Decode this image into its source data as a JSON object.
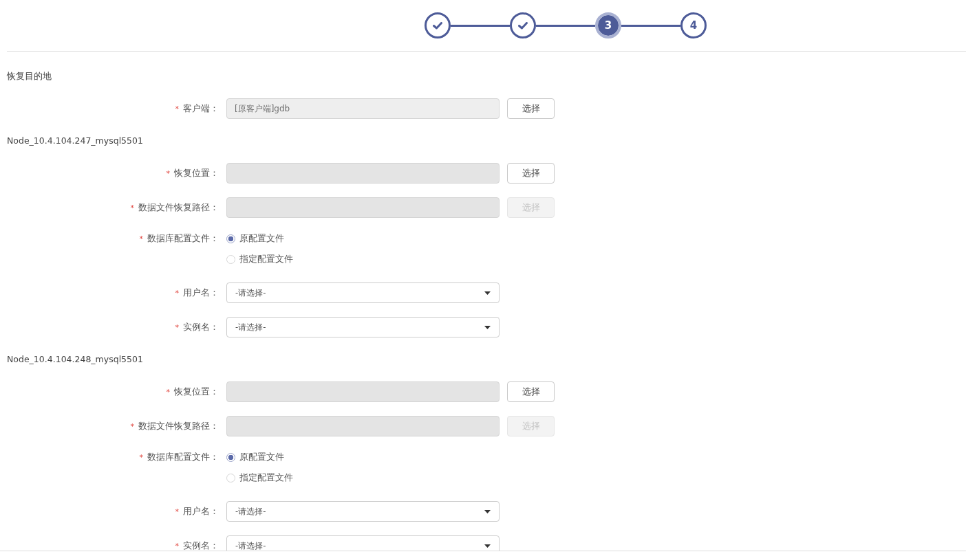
{
  "steps": [
    {
      "completed": true,
      "selected": false
    },
    {
      "completed": true,
      "selected": false
    },
    {
      "completed": false,
      "selected": true,
      "label": "3"
    },
    {
      "completed": false,
      "selected": false,
      "label": "4"
    }
  ],
  "sections": [
    {
      "title": "恢复目的地",
      "fields": [
        {
          "kind": "input",
          "mark": "*",
          "label": "客户端：",
          "value": "[原客户端]gdb",
          "button": {
            "label": "选择",
            "disabled": false
          }
        }
      ]
    },
    {
      "title": "Node_10.4.104.247_mysql5501",
      "fields": [
        {
          "kind": "input",
          "mark": "*",
          "label": "恢复位置：",
          "button": {
            "label": "选择",
            "disabled": false
          }
        },
        {
          "kind": "input",
          "mark": "*",
          "label": "数据文件恢复路径：",
          "button": {
            "label": "选择",
            "disabled": true
          }
        },
        {
          "kind": "radio",
          "mark": "*",
          "label": "数据库配置文件：",
          "options": [
            {
              "label": "原配置文件",
              "selected": true
            },
            {
              "label": "指定配置文件",
              "selected": false
            }
          ]
        },
        {
          "kind": "select",
          "mark": "*",
          "label": "用户名：",
          "value": "-请选择-"
        },
        {
          "kind": "select",
          "mark": "*",
          "label": "实例名：",
          "value": "-请选择-"
        }
      ]
    },
    {
      "title": "Node_10.4.104.248_mysql5501",
      "fields": [
        {
          "kind": "input",
          "mark": "*",
          "label": "恢复位置：",
          "button": {
            "label": "选择",
            "disabled": false
          }
        },
        {
          "kind": "input",
          "mark": "*",
          "label": "数据文件恢复路径：",
          "button": {
            "label": "选择",
            "disabled": true
          }
        },
        {
          "kind": "radio",
          "mark": "*",
          "label": "数据库配置文件：",
          "options": [
            {
              "label": "原配置文件",
              "selected": true
            },
            {
              "label": "指定配置文件",
              "selected": false
            }
          ]
        },
        {
          "kind": "select",
          "mark": "*",
          "label": "用户名：",
          "value": "-请选择-"
        },
        {
          "kind": "select",
          "mark": "*",
          "label": "实例名：",
          "value": "-请选择-"
        }
      ]
    }
  ]
}
